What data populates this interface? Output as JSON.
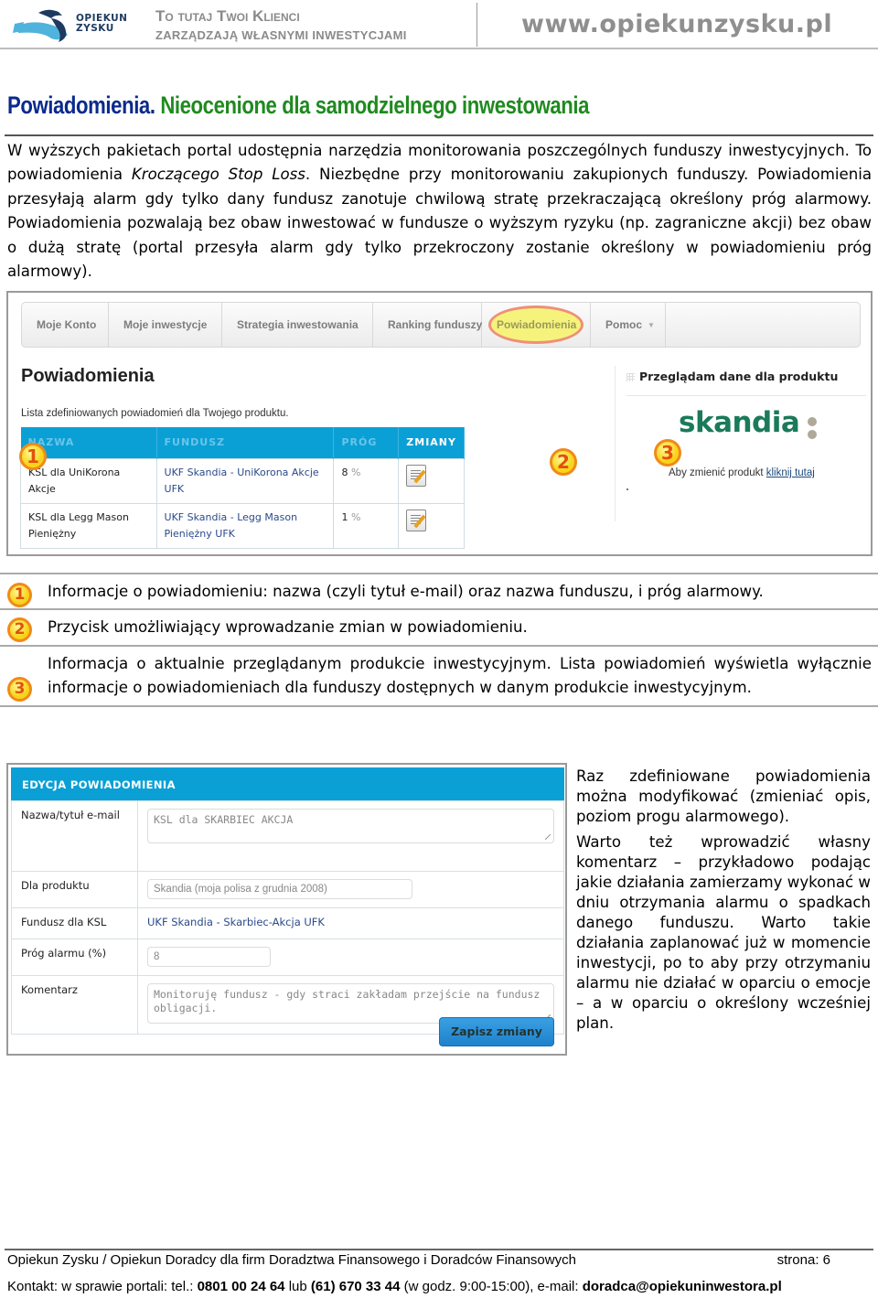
{
  "header": {
    "logo_line1": "OPIEKUN",
    "logo_line2": "ZYSKU",
    "tagline_line1": "To tutaj Twoi Klienci",
    "tagline_line2": "zarządzają własnymi inwestycjami",
    "url": "www.opiekunzysku.pl"
  },
  "title": {
    "part1": "Powiadomienia.",
    "part2": "Nieocenione dla samodzielnego inwestowania"
  },
  "intro": {
    "before_italic": "W wyższych pakietach portal udostępnia narzędzia monitorowania poszczególnych funduszy inwestycyjnych. To powiadomienia ",
    "italic": "Kroczącego Stop Loss",
    "after_italic": ". Niezbędne przy monitorowaniu zakupionych funduszy. Powiadomienia przesyłają alarm gdy tylko dany fundusz zanotuje chwilową stratę przekraczającą określony próg alarmowy. Powiadomienia pozwalają bez obaw inwestować w fundusze o wyższym ryzyku (np. zagraniczne akcji) bez obaw o dużą stratę (portal przesyła alarm gdy tylko przekroczony zostanie określony w powiadomieniu próg alarmowy)."
  },
  "screenshot1": {
    "nav": [
      {
        "label": "Moje Konto",
        "dropdown": false
      },
      {
        "label": "Moje inwestycje",
        "dropdown": false
      },
      {
        "label": "Strategia inwestowania",
        "dropdown": false
      },
      {
        "label": "Ranking funduszy",
        "dropdown": true
      },
      {
        "label": "Powiadomienia",
        "dropdown": false,
        "active": true
      },
      {
        "label": "Pomoc",
        "dropdown": true
      }
    ],
    "caret": "▼",
    "page_heading": "Powiadomienia",
    "page_subtitle": "Lista zdefiniowanych powiadomień dla Twojego produktu.",
    "table": {
      "columns": [
        "NAZWA",
        "FUNDUSZ",
        "PRÓG",
        "ZMIANY"
      ],
      "rows": [
        {
          "name": "KSL dla UniKorona Akcje",
          "fund": "UKF Skandia - UniKorona Akcje UFK",
          "threshold": "8",
          "unit": "%"
        },
        {
          "name": "KSL dla Legg Mason Pieniężny",
          "fund": "UKF Skandia - Legg Mason Pieniężny UFK",
          "threshold": "1",
          "unit": "%"
        }
      ]
    },
    "sidebar": {
      "title": "Przeglądam dane dla produktu",
      "brand": "skandia",
      "change_text": "Aby zmienić produkt ",
      "change_link": "kliknij tutaj"
    },
    "badges": [
      "1",
      "2",
      "3"
    ]
  },
  "legend": [
    {
      "num": "1",
      "text": "Informacje o powiadomieniu: nazwa (czyli tytuł e-mail) oraz nazwa funduszu, i próg alarmowy."
    },
    {
      "num": "2",
      "text": "Przycisk umożliwiający wprowadzanie zmian w powiadomieniu."
    },
    {
      "num": "3",
      "text": "Informacja o aktualnie przeglądanym produkcie inwestycyjnym. Lista powiadomień wyświetla wyłącznie informacje o powiadomieniach dla funduszy dostępnych w danym produkcie inwestycyjnym."
    }
  ],
  "screenshot2": {
    "heading": "EDYCJA POWIADOMIENIA",
    "fields": {
      "name_label": "Nazwa/tytuł e-mail",
      "name_value": "KSL dla SKARBIEC AKCJA",
      "product_label": "Dla produktu",
      "product_value": "Skandia (moja polisa z grudnia 2008)",
      "fund_label": "Fundusz dla KSL",
      "fund_value": "UKF Skandia - Skarbiec-Akcja UFK",
      "threshold_label": "Próg alarmu (%)",
      "threshold_value": "8",
      "comment_label": "Komentarz",
      "comment_value": "Monitoruję fundusz - gdy straci zakładam przejście na fundusz obligacji."
    },
    "save_button": "Zapisz zmiany"
  },
  "side_text": {
    "p1": "Raz zdefiniowane powiadomienia można modyfikować (zmieniać opis, poziom progu alarmowego).",
    "p2": "Warto też wprowadzić własny komentarz – przykładowo podając jakie działania zamierzamy wykonać w dniu otrzymania alarmu o spadkach danego funduszu. Warto takie działania zaplanować już w momencie inwestycji, po to aby przy otrzymaniu alarmu nie działać w oparciu o emocje – a w oparciu o określony wcześniej plan."
  },
  "footer": {
    "line1": "Opiekun Zysku / Opiekun Doradcy dla firm Doradztwa Finansowego i Doradców Finansowych",
    "page": "strona: 6",
    "contact_prefix": "Kontakt: w sprawie portali: tel.: ",
    "phone1": "0801 00 24 64",
    "contact_or": " lub ",
    "phone2": "(61) 670 33 44",
    "hours": " (w godz. 9:00-15:00), e-mail: ",
    "email": "doradca@opiekuninwestora.pl"
  },
  "colors": {
    "title_blue": "#0a2a8c",
    "title_green": "#1f8a1f",
    "table_header": "#0aa0d6",
    "skandia_green": "#1a7a5a",
    "badge_fill": "#f7d41a",
    "badge_border": "#f08a1a",
    "highlight_yellow": "#f6f37c"
  }
}
